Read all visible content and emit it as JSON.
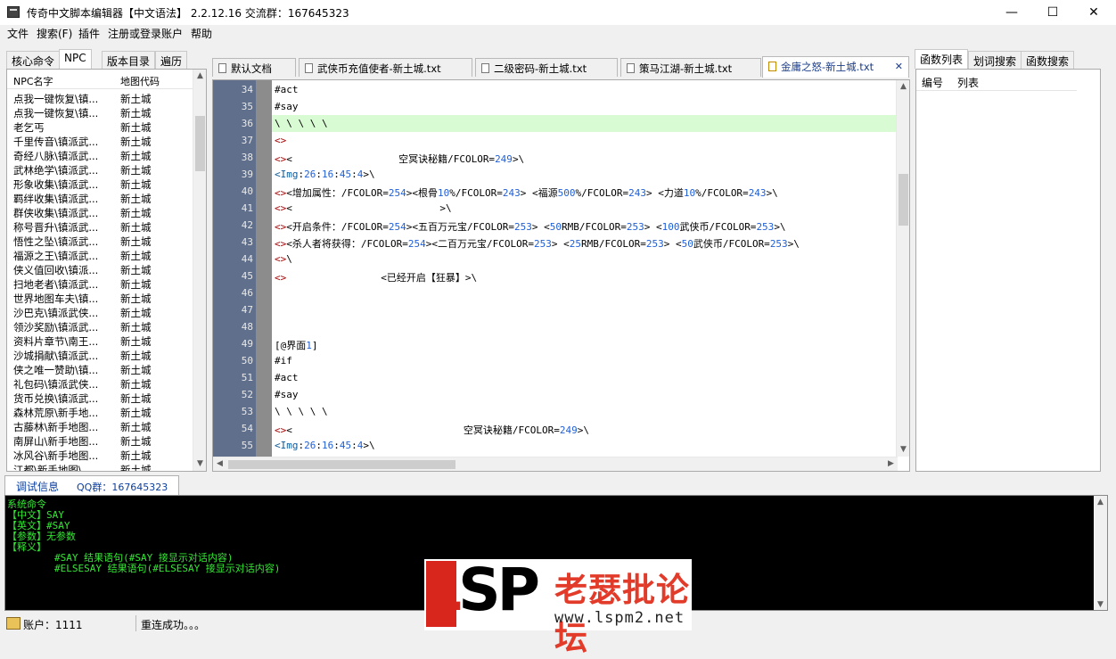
{
  "window": {
    "title": "传奇中文脚本编辑器【中文语法】 2.2.12.16 交流群：167645323",
    "minimize": "—",
    "maximize": "☐",
    "close": "✕"
  },
  "menu": [
    "文件",
    "搜索(F)",
    "插件",
    "注册或登录账户",
    "帮助"
  ],
  "left_tabs": [
    "核心命令",
    "NPC",
    "版本目录",
    "遍历"
  ],
  "npc_list": {
    "headers": [
      "NPC名字",
      "地图代码"
    ],
    "rows": [
      [
        "点我一键恢复\\镇...",
        "新土城"
      ],
      [
        "点我一键恢复\\镇...",
        "新土城"
      ],
      [
        "老乞丐",
        "新土城"
      ],
      [
        "千里传音\\镇派武...",
        "新土城"
      ],
      [
        "奇经八脉\\镇派武...",
        "新土城"
      ],
      [
        "武林绝学\\镇派武...",
        "新土城"
      ],
      [
        "形象收集\\镇派武...",
        "新土城"
      ],
      [
        "羁绊收集\\镇派武...",
        "新土城"
      ],
      [
        "群侠收集\\镇派武...",
        "新土城"
      ],
      [
        "称号晋升\\镇派武...",
        "新土城"
      ],
      [
        "悟性之坠\\镇派武...",
        "新土城"
      ],
      [
        "福源之王\\镇派武...",
        "新土城"
      ],
      [
        "侠义值回收\\镇派...",
        "新土城"
      ],
      [
        "扫地老者\\镇派武...",
        "新土城"
      ],
      [
        "世界地图车夫\\镇...",
        "新土城"
      ],
      [
        "沙巴克\\镇派武侠...",
        "新土城"
      ],
      [
        "领沙奖励\\镇派武...",
        "新土城"
      ],
      [
        "资料片章节\\南王...",
        "新土城"
      ],
      [
        "沙城捐献\\镇派武...",
        "新土城"
      ],
      [
        "侠之唯一赞助\\镇...",
        "新土城"
      ],
      [
        "礼包码\\镇派武侠...",
        "新土城"
      ],
      [
        "货币兑换\\镇派武...",
        "新土城"
      ],
      [
        "森林荒原\\新手地...",
        "新土城"
      ],
      [
        "古藤林\\新手地图...",
        "新土城"
      ],
      [
        "南屏山\\新手地图...",
        "新土城"
      ],
      [
        "冰风谷\\新手地图...",
        "新土城"
      ],
      [
        "江都\\新手地图\\...",
        "新土城"
      ]
    ]
  },
  "editor_tabs": [
    {
      "label": "默认文档",
      "active": false
    },
    {
      "label": "武侠币充值使者-新土城.txt",
      "active": false
    },
    {
      "label": "二级密码-新土城.txt",
      "active": false
    },
    {
      "label": "策马江湖-新土城.txt",
      "active": false
    },
    {
      "label": "金庸之怒-新土城.txt",
      "active": true
    }
  ],
  "editor_tab_close": "✕",
  "code_lines": [
    {
      "n": "34",
      "text": "#act"
    },
    {
      "n": "35",
      "text": "#say"
    },
    {
      "n": "36",
      "text": "\\ \\ \\ \\ \\",
      "highlight": true
    },
    {
      "n": "37",
      "text": "<>"
    },
    {
      "n": "38",
      "text": "<><                  空冥诀秘籍/FCOLOR=249>\\"
    },
    {
      "n": "39",
      "text": "<Img:26:16:45:4>\\"
    },
    {
      "n": "40",
      "text": "<><增加属性：/FCOLOR=254><根骨10%/FCOLOR=243> <福源500%/FCOLOR=243> <力道10%/FCOLOR=243>\\"
    },
    {
      "n": "41",
      "text": "<><                         >\\"
    },
    {
      "n": "42",
      "text": "<><开启条件：/FCOLOR=254><五百万元宝/FCOLOR=253> <50RMB/FCOLOR=253> <100武侠币/FCOLOR=253>\\"
    },
    {
      "n": "43",
      "text": "<><杀人者将获得：/FCOLOR=254><二百万元宝/FCOLOR=253> <25RMB/FCOLOR=253> <50武侠币/FCOLOR=253>\\"
    },
    {
      "n": "44",
      "text": "<>\\"
    },
    {
      "n": "45",
      "text": "<>                <已经开启【狂暴】>\\"
    },
    {
      "n": "46",
      "text": ""
    },
    {
      "n": "47",
      "text": ""
    },
    {
      "n": "48",
      "text": ""
    },
    {
      "n": "49",
      "text": "[@界面1]"
    },
    {
      "n": "50",
      "text": "#if"
    },
    {
      "n": "51",
      "text": "#act"
    },
    {
      "n": "52",
      "text": "#say"
    },
    {
      "n": "53",
      "text": "\\ \\ \\ \\ \\"
    },
    {
      "n": "54",
      "text": "<><                             空冥诀秘籍/FCOLOR=249>\\"
    },
    {
      "n": "55",
      "text": "<Img:26:16:45:4>\\"
    }
  ],
  "right_tabs": [
    "函数列表",
    "划词搜索",
    "函数搜索"
  ],
  "right_headers": [
    "编号",
    "列表"
  ],
  "bottom_tab": {
    "label": "调试信息",
    "qq": "QQ群：167645323"
  },
  "console_lines": [
    "系统命令",
    "【中文】SAY",
    "【英文】#SAY",
    "【参数】无参数",
    "【释义】",
    "        #SAY 结果语句(#SAY 接显示对话内容)",
    "        #ELSESAY 结果语句(#ELSESAY 接显示对话内容)"
  ],
  "status": {
    "account": "账户：1111",
    "message": "重连成功。。。"
  },
  "watermark": {
    "logo": "LSP",
    "name": "老瑟批论坛",
    "url": "www.lspm2.net"
  },
  "colors": {
    "gutter": "#5f6f8c",
    "highlight_line": "#d9fbd4",
    "console_bg": "#000000",
    "console_text": "#33e833",
    "watermark_red": "#d9261c"
  }
}
